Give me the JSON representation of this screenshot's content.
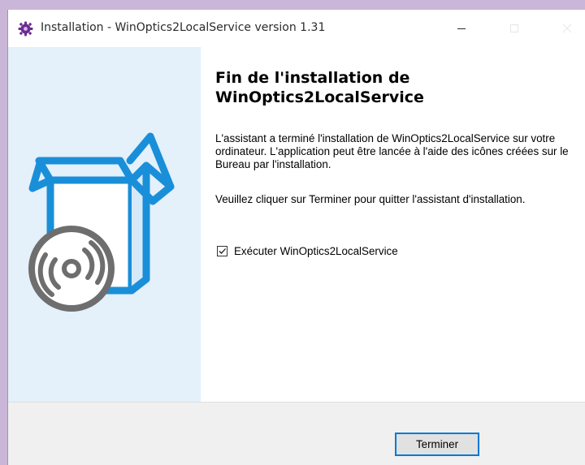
{
  "window": {
    "title": "Installation - WinOptics2LocalService version 1.31",
    "icon": "installer-gear-icon"
  },
  "controls": {
    "minimize": "minimize-icon",
    "maximize": "maximize-icon",
    "close": "close-icon"
  },
  "sidebar": {
    "image": "box-with-disc-icon",
    "accent_color": "#1a8fd9",
    "background": "#e4f0fa"
  },
  "content": {
    "heading": "Fin de l'installation de WinOptics2LocalService",
    "paragraph1": "L'assistant a terminé l'installation de WinOptics2LocalService sur votre ordinateur. L'application peut être lancée à l'aide des icônes créées sur le Bureau par l'installation.",
    "paragraph2": "Veuillez cliquer sur Terminer pour quitter l'assistant d'installation.",
    "run_checkbox": {
      "label": "Exécuter WinOptics2LocalService",
      "checked": true
    }
  },
  "footer": {
    "finish_label": "Terminer"
  }
}
